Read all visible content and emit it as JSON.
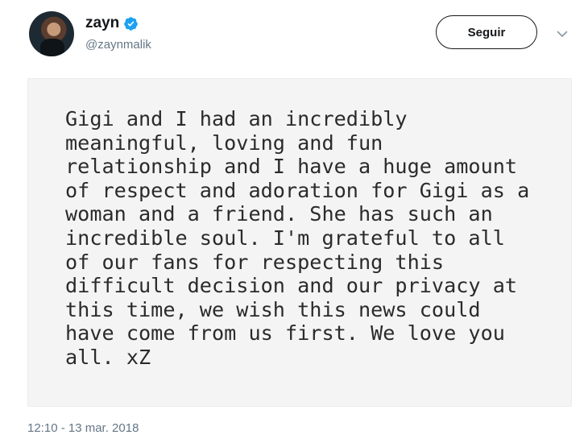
{
  "author": {
    "display_name": "zayn",
    "handle": "@zaynmalik",
    "verified": true,
    "verified_color": "#1da1f2"
  },
  "actions": {
    "follow_label": "Seguir"
  },
  "media": {
    "statement_lines": [
      "Gigi and I had an incredibly",
      "meaningful, loving and fun",
      "relationship and I have a huge amount",
      "of respect and adoration for Gigi as a",
      "woman and a friend. She has such an",
      "incredible soul. I'm grateful to all",
      "of our fans for respecting this",
      "difficult decision and our privacy at",
      "this time, we wish this news could",
      "have come from us first. We love you",
      "all. xZ"
    ]
  },
  "meta": {
    "timestamp": "12:10 - 13 mar. 2018"
  },
  "icons": {
    "verified": "verified-badge-icon",
    "menu": "chevron-down-icon"
  }
}
